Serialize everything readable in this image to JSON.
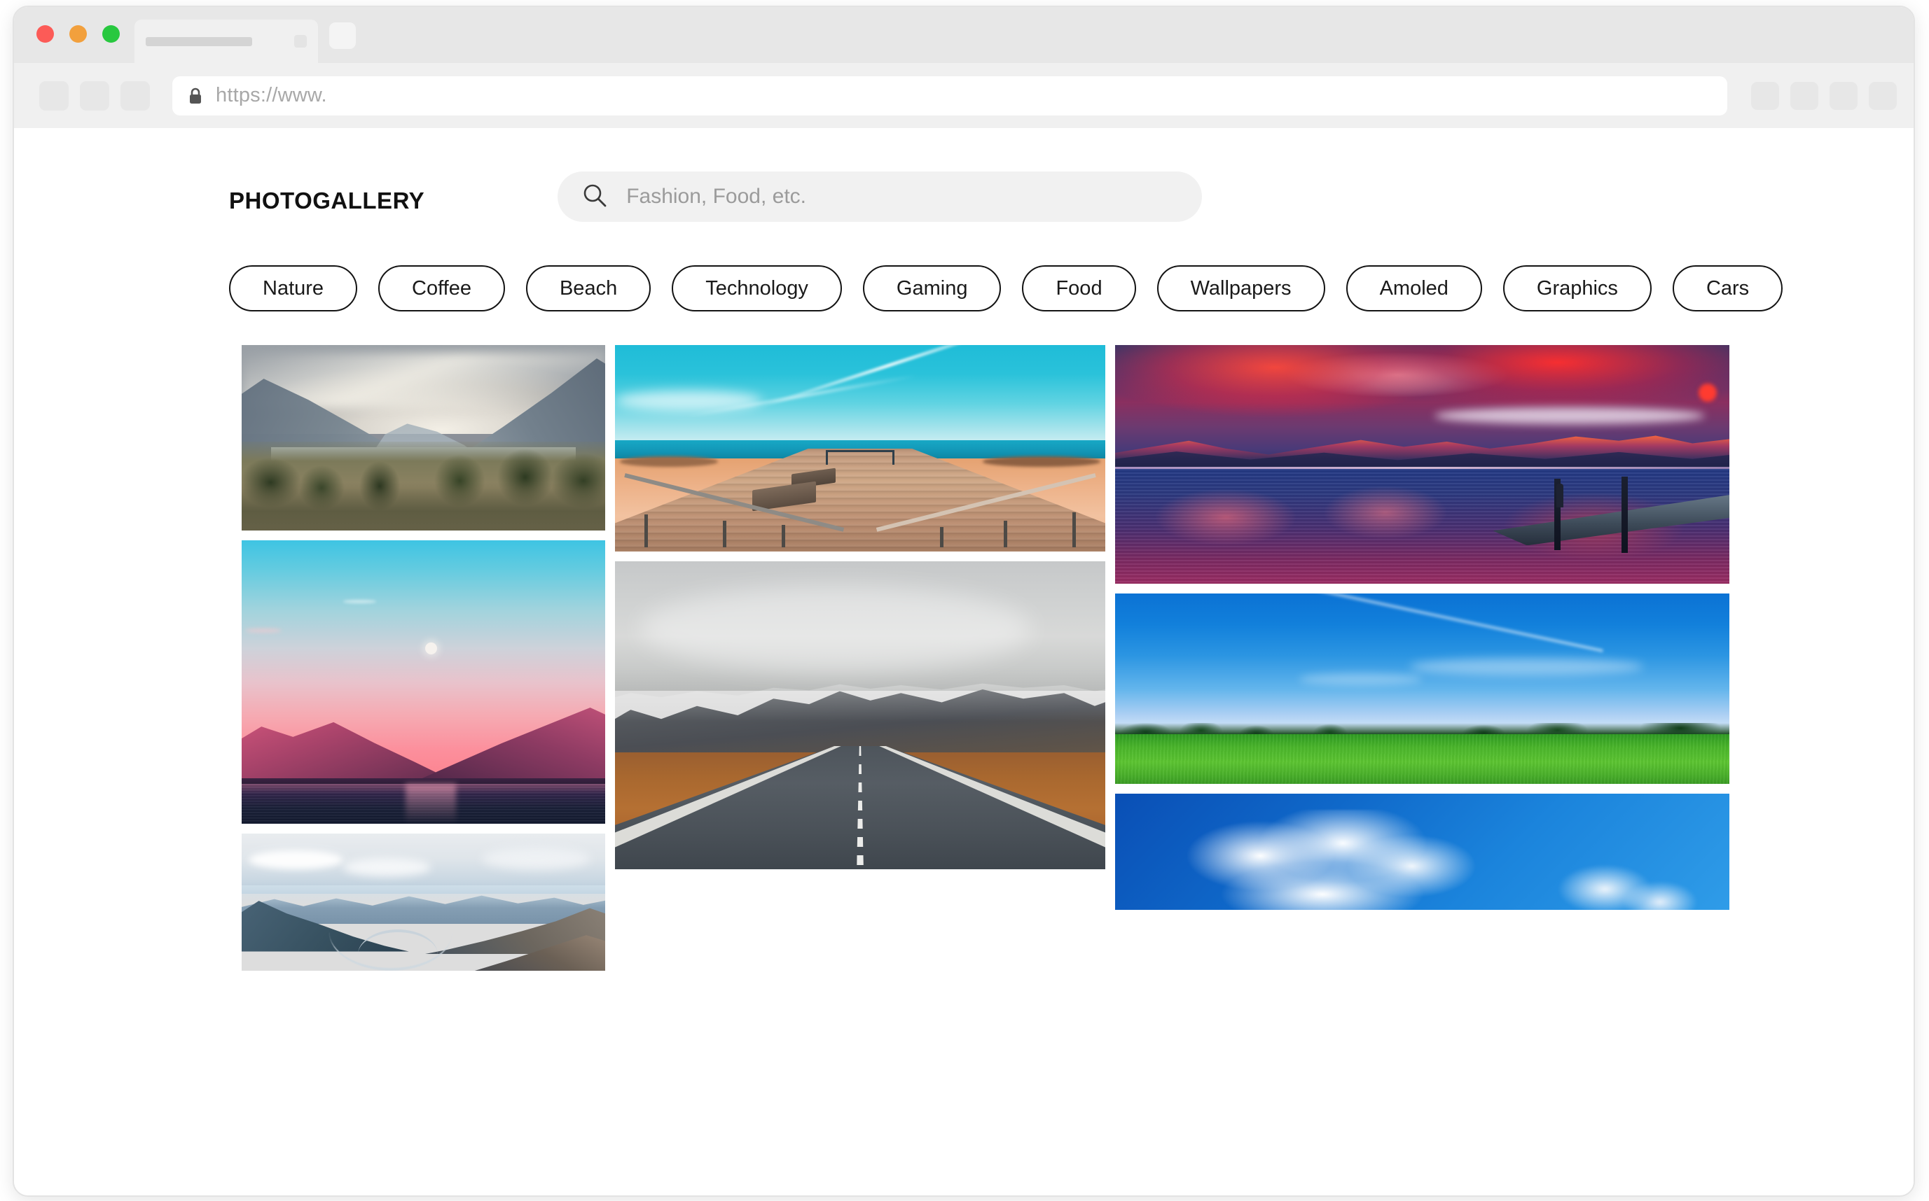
{
  "browser": {
    "traffic_lights": [
      "close",
      "minimize",
      "maximize"
    ],
    "tab": {
      "title_placeholder": "",
      "close_label": ""
    },
    "new_tab_label": "",
    "nav_buttons": [
      "back",
      "forward",
      "reload"
    ],
    "url": {
      "value": "https://www.",
      "lock": "secure"
    },
    "right_buttons": [
      "extension",
      "profile",
      "bookmark",
      "menu"
    ]
  },
  "site": {
    "brand": "PhotoGallery",
    "search": {
      "placeholder": "Fashion, Food, etc.",
      "value": "",
      "icon": "search-icon"
    },
    "categories": [
      {
        "label": "Nature"
      },
      {
        "label": "Coffee"
      },
      {
        "label": "Beach"
      },
      {
        "label": "Technology"
      },
      {
        "label": "Gaming"
      },
      {
        "label": "Food"
      },
      {
        "label": "Wallpapers"
      },
      {
        "label": "Amoled"
      },
      {
        "label": "Graphics"
      },
      {
        "label": "Cars"
      }
    ],
    "gallery": {
      "columns": [
        {
          "id": "col-1",
          "photos": [
            {
              "id": "p1",
              "alt": "Misty mountain lake with pine forest"
            },
            {
              "id": "p2",
              "alt": "Pink and teal sunset over mountains with moon"
            },
            {
              "id": "p3",
              "alt": "Aerial view of mountain range with winding river"
            }
          ]
        },
        {
          "id": "col-2",
          "photos": [
            {
              "id": "p4",
              "alt": "Wooden beach boardwalk with benches and turquoise sea"
            },
            {
              "id": "p5",
              "alt": "Empty road through Icelandic mountains under overcast sky"
            }
          ]
        },
        {
          "id": "col-3",
          "photos": [
            {
              "id": "p6",
              "alt": "Red sunset over mountain lake with pier reflection"
            },
            {
              "id": "p7",
              "alt": "Green grass field under vivid blue sky"
            },
            {
              "id": "p8",
              "alt": "White cumulus clouds on deep blue sky"
            }
          ]
        }
      ]
    }
  },
  "colors": {
    "chip_border": "#131313",
    "search_bg": "#f1f1f1",
    "brand_text": "#111111",
    "placeholder_text": "#9b9b9b",
    "url_text": "#a8a8a8",
    "chrome_bg": "#e7e7e7",
    "toolbar_bg": "#f0f0f0"
  }
}
